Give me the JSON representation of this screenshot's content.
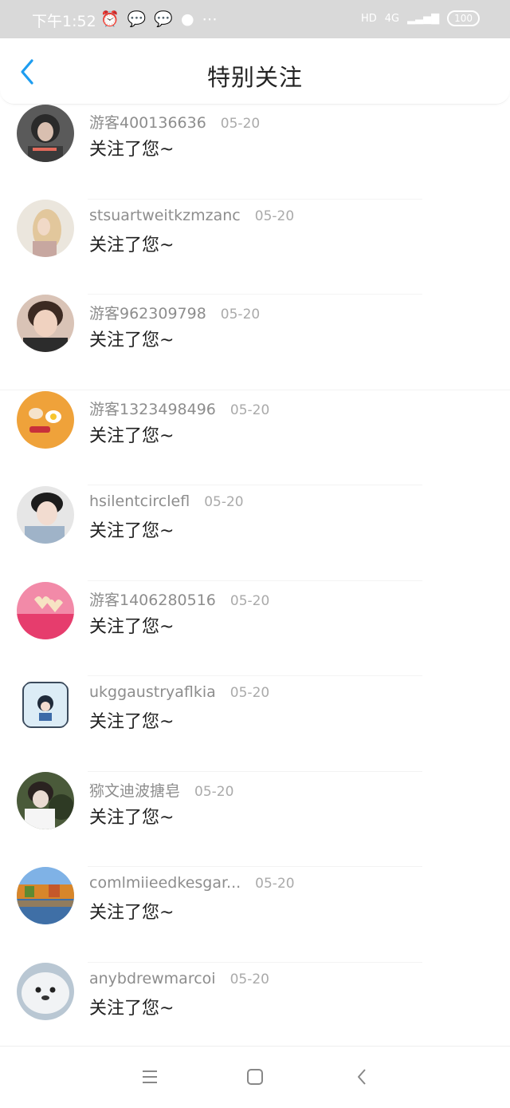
{
  "status_bar": {
    "time": "下午1:52",
    "left_icons": [
      "alarm-icon",
      "wechat-icon",
      "wechat-icon",
      "app-icon",
      "more-icon"
    ],
    "hd": "HD",
    "network": "4G",
    "battery": "100"
  },
  "header": {
    "title": "特别关注",
    "back_icon": "back-chevron-icon",
    "accent_color": "#1e9df0"
  },
  "items": [
    {
      "name": "游客400136636",
      "date": "05-20",
      "message": "关注了您~"
    },
    {
      "name": "stsuartweitkzmzanc",
      "date": "05-20",
      "message": "关注了您~"
    },
    {
      "name": "游客962309798",
      "date": "05-20",
      "message": "关注了您~"
    },
    {
      "name": "游客1323498496",
      "date": "05-20",
      "message": "关注了您~"
    },
    {
      "name": "hsilentcirclefl",
      "date": "05-20",
      "message": "关注了您~"
    },
    {
      "name": "游客1406280516",
      "date": "05-20",
      "message": "关注了您~"
    },
    {
      "name": "ukggaustryaflkia",
      "date": "05-20",
      "message": "关注了您~"
    },
    {
      "name": "猕文迪波搪皂",
      "date": "05-20",
      "message": "关注了您~"
    },
    {
      "name": "comlmiieedkesgar...",
      "date": "05-20",
      "message": "关注了您~"
    },
    {
      "name": "anybdrewmarcoi",
      "date": "05-20",
      "message": "关注了您~"
    }
  ],
  "nav_bar": {
    "icons": [
      "menu-icon",
      "home-square-icon",
      "back-triangle-icon"
    ]
  }
}
